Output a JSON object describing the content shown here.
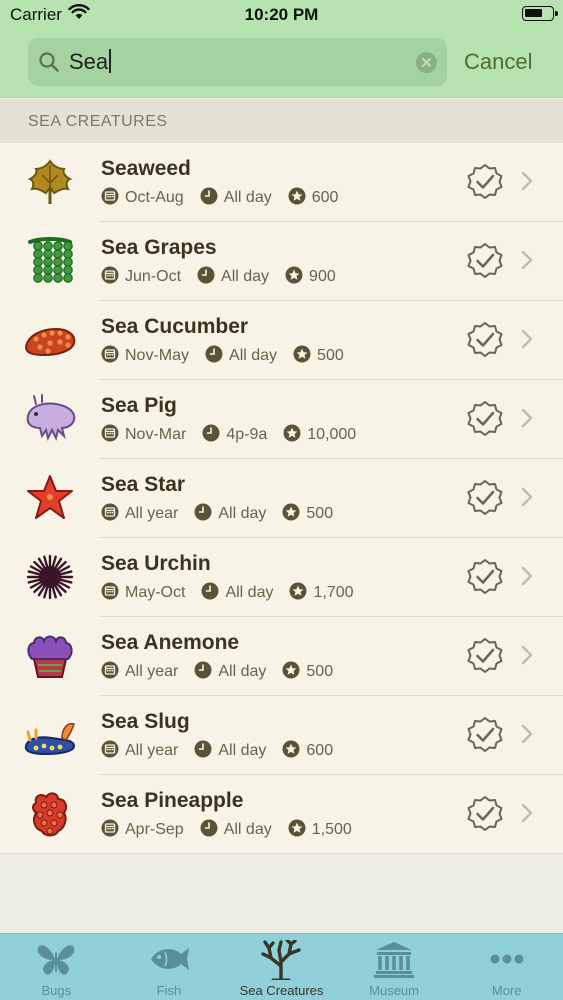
{
  "status_bar": {
    "carrier": "Carrier",
    "time": "10:20 PM"
  },
  "search": {
    "query": "Sea",
    "cancel_label": "Cancel"
  },
  "section_header": "SEA CREATURES",
  "items": [
    {
      "name": "Seaweed",
      "season": "Oct-Aug",
      "time": "All day",
      "price": "600",
      "icon": "seaweed-icon",
      "color": "#b08a1e"
    },
    {
      "name": "Sea Grapes",
      "season": "Jun-Oct",
      "time": "All day",
      "price": "900",
      "icon": "sea-grapes-icon",
      "color": "#3f9a3c"
    },
    {
      "name": "Sea Cucumber",
      "season": "Nov-May",
      "time": "All day",
      "price": "500",
      "icon": "sea-cucumber-icon",
      "color": "#c8451f"
    },
    {
      "name": "Sea Pig",
      "season": "Nov-Mar",
      "time": "4p-9a",
      "price": "10,000",
      "icon": "sea-pig-icon",
      "color": "#c9aee0"
    },
    {
      "name": "Sea Star",
      "season": "All year",
      "time": "All day",
      "price": "500",
      "icon": "sea-star-icon",
      "color": "#e0402a"
    },
    {
      "name": "Sea Urchin",
      "season": "May-Oct",
      "time": "All day",
      "price": "1,700",
      "icon": "sea-urchin-icon",
      "color": "#3a1528"
    },
    {
      "name": "Sea Anemone",
      "season": "All year",
      "time": "All day",
      "price": "500",
      "icon": "sea-anemone-icon",
      "color": "#8b4fb8"
    },
    {
      "name": "Sea Slug",
      "season": "All year",
      "time": "All day",
      "price": "600",
      "icon": "sea-slug-icon",
      "color": "#2f4fa8"
    },
    {
      "name": "Sea Pineapple",
      "season": "Apr-Sep",
      "time": "All day",
      "price": "1,500",
      "icon": "sea-pineapple-icon",
      "color": "#d83a2a"
    }
  ],
  "tabs": [
    {
      "label": "Bugs",
      "icon": "butterfly-icon",
      "active": false
    },
    {
      "label": "Fish",
      "icon": "fish-icon",
      "active": false
    },
    {
      "label": "Sea Creatures",
      "icon": "coral-icon",
      "active": true
    },
    {
      "label": "Museum",
      "icon": "museum-icon",
      "active": false
    },
    {
      "label": "More",
      "icon": "more-dots-icon",
      "active": false
    }
  ]
}
